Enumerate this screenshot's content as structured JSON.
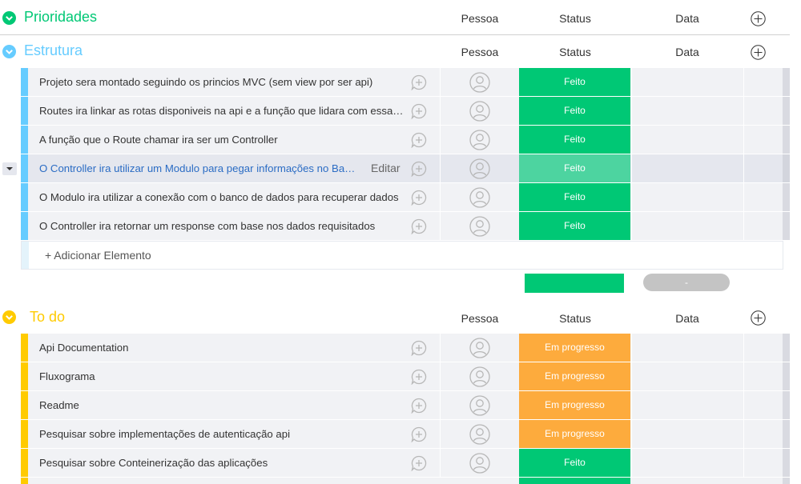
{
  "columns": {
    "person": "Pessoa",
    "status": "Status",
    "date": "Data"
  },
  "colors": {
    "green_group": "#00c875",
    "blue_group": "#579bfc",
    "yellow_group": "#ffcb00",
    "done": "#00c875",
    "in_progress": "#fdab3d",
    "edit_link": "#2b6cc4"
  },
  "groups": [
    {
      "title": "Prioridades",
      "color": "#00c875",
      "rows": []
    },
    {
      "title": "Estrutura",
      "color": "#66ccff",
      "rows": [
        {
          "name": "Projeto sera montado seguindo os princios MVC (sem view por ser api)",
          "status": "Feito"
        },
        {
          "name": "Routes ira linkar as rotas disponiveis na api e a função que lidara com essa r...",
          "status": "Feito"
        },
        {
          "name": "A função que o Route chamar ira ser um Controller",
          "status": "Feito"
        },
        {
          "name": "O Controller ira utilizar um Modulo para pegar informações no Ban...",
          "status": "Feito",
          "edit": "Editar"
        },
        {
          "name": "O Modulo ira utilizar a conexão com o banco de dados para recuperar dados",
          "status": "Feito"
        },
        {
          "name": "O Controller ira retornar um response com base nos dados requisitados",
          "status": "Feito"
        }
      ],
      "add_item": "+ Adicionar Elemento",
      "summary_pill": "-"
    },
    {
      "title": "To do",
      "color": "#ffcb00",
      "rows": [
        {
          "name": "Api Documentation",
          "status": "Em progresso"
        },
        {
          "name": "Fluxograma",
          "status": "Em progresso"
        },
        {
          "name": "Readme",
          "status": "Em progresso"
        },
        {
          "name": "Pesquisar sobre implementações de autenticação api",
          "status": "Em progresso"
        },
        {
          "name": "Pesquisar sobre Conteinerização das aplicações",
          "status": "Feito"
        }
      ]
    }
  ]
}
